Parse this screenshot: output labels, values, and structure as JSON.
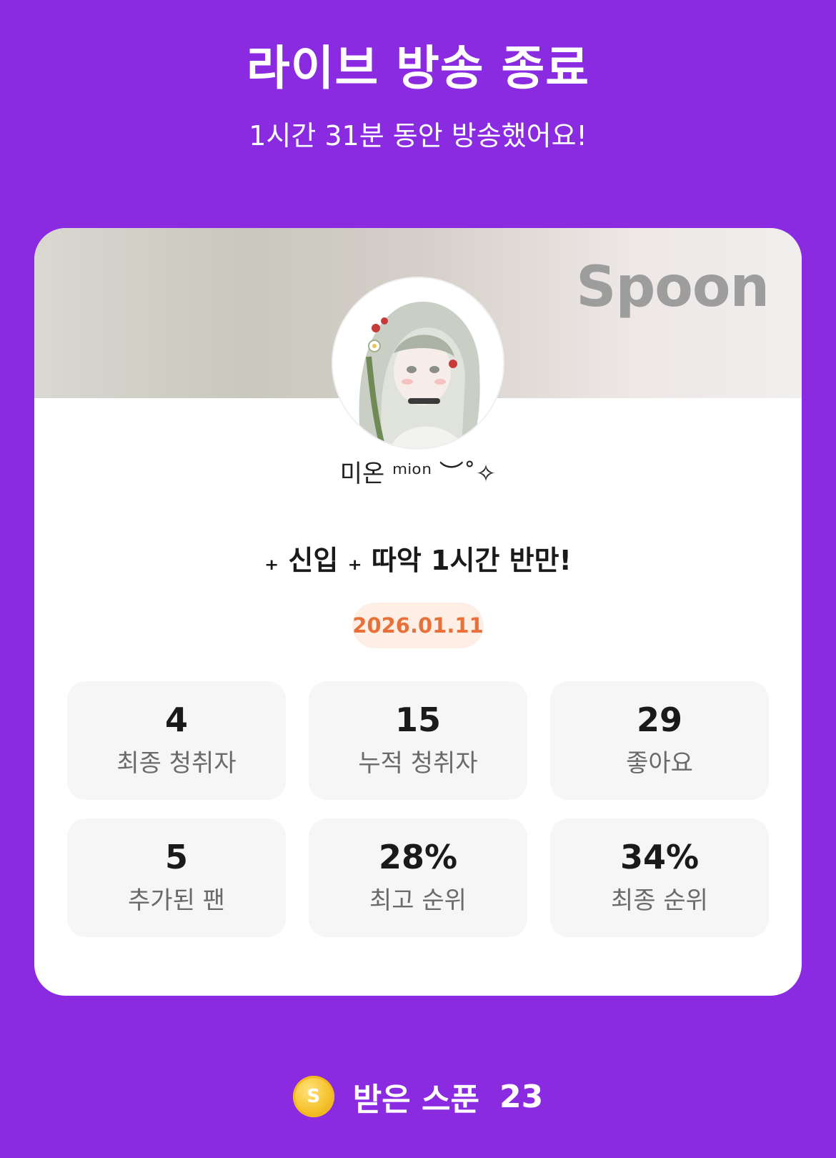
{
  "header": {
    "title": "라이브 방송 종료",
    "subtitle": "1시간 31분 동안 방송했어요!"
  },
  "card": {
    "brand": "Spoon",
    "username": "미온 ᵐⁱᵒⁿ ︶˚✧",
    "broadcast_title": "₊ 신입 ₊ 따악 1시간 반만!",
    "date": "2026.01.11",
    "stats": [
      {
        "value": "4",
        "label": "최종 청취자"
      },
      {
        "value": "15",
        "label": "누적 청취자"
      },
      {
        "value": "29",
        "label": "좋아요"
      },
      {
        "value": "5",
        "label": "추가된 팬"
      },
      {
        "value": "28%",
        "label": "최고 순위"
      },
      {
        "value": "34%",
        "label": "최종 순위"
      }
    ]
  },
  "footer": {
    "coin_icon": "spoon-coin-icon",
    "coin_letter": "S",
    "label": "받은 스푼",
    "value": "23"
  },
  "colors": {
    "background": "#8a2be2",
    "date_text": "#e8713a",
    "date_bg": "#fdeee6",
    "stat_bg": "#f6f6f6",
    "coin": "#f6c22e"
  }
}
